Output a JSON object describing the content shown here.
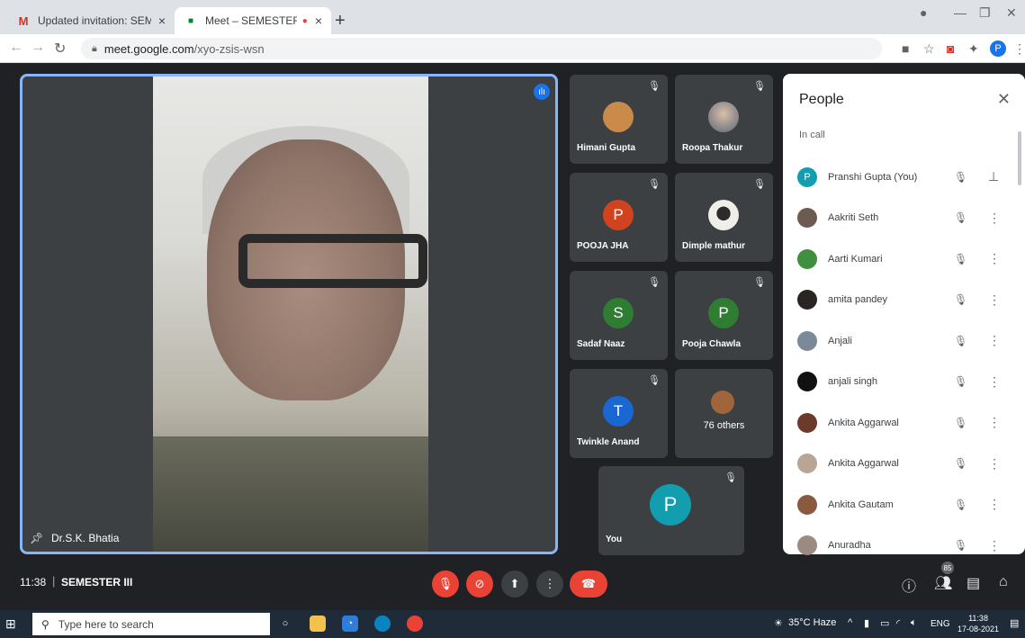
{
  "browser": {
    "tabs": [
      {
        "label": "Updated invitation: SEMESTER III",
        "close": "×",
        "favicon": "gmail-icon",
        "favicon_glyph": "M"
      },
      {
        "label": "Meet – SEMESTER III",
        "close": "×",
        "favicon": "meet-icon",
        "favicon_glyph": "■"
      }
    ],
    "url_host": "meet.google.com",
    "url_path": "/xyo-zsis-wsn",
    "profile_initial": "P"
  },
  "main_tile": {
    "name": "Dr.S.K. Bhatia"
  },
  "tiles": [
    {
      "name": "Himani Gupta",
      "avatar_type": "photo",
      "avatar_color": "#c98a4a"
    },
    {
      "name": "Roopa Thakur",
      "avatar_type": "photo",
      "avatar_color": "#8a8fa8"
    },
    {
      "name": "POOJA JHA",
      "avatar_type": "initial",
      "initial": "P",
      "avatar_color": "#d1421f"
    },
    {
      "name": "Dimple mathur",
      "avatar_type": "photo",
      "avatar_color": "#e8e6e1"
    },
    {
      "name": "Sadaf Naaz",
      "avatar_type": "initial",
      "initial": "S",
      "avatar_color": "#2e7d32"
    },
    {
      "name": "Pooja Chawla",
      "avatar_type": "initial",
      "initial": "P",
      "avatar_color": "#2e7d32"
    },
    {
      "name": "Twinkle Anand",
      "avatar_type": "initial",
      "initial": "T",
      "avatar_color": "#1967d2"
    },
    {
      "name": "76 others",
      "avatar_type": "group",
      "avatar_color": "#a0653a"
    }
  ],
  "self_tile": {
    "name": "You",
    "initial": "P",
    "avatar_color": "#129eaf"
  },
  "people": {
    "title": "People",
    "section": "In call",
    "participants": [
      {
        "name": "Pranshi Gupta (You)",
        "avatar_type": "initial",
        "initial": "P",
        "avatar_color": "#129eaf",
        "action": "pin"
      },
      {
        "name": "Aakriti Seth",
        "avatar_color": "#6d5a50",
        "action": "more"
      },
      {
        "name": "Aarti Kumari",
        "avatar_color": "#3f8f3f",
        "action": "more"
      },
      {
        "name": "amita pandey",
        "avatar_color": "#2a2522",
        "action": "more"
      },
      {
        "name": "Anjali",
        "avatar_color": "#7a8a99",
        "action": "more"
      },
      {
        "name": "anjali singh",
        "avatar_color": "#111111",
        "action": "more"
      },
      {
        "name": "Ankita Aggarwal",
        "avatar_color": "#6b3a2a",
        "action": "more"
      },
      {
        "name": "Ankita Aggarwal",
        "avatar_color": "#b9a596",
        "action": "more"
      },
      {
        "name": "Ankita Gautam",
        "avatar_color": "#8a5a40",
        "action": "more"
      },
      {
        "name": "Anuradha",
        "avatar_color": "#9a8a80",
        "action": "more"
      }
    ]
  },
  "meeting": {
    "time": "11:38",
    "separator": "|",
    "name": "SEMESTER III",
    "participant_count": "85"
  },
  "taskbar": {
    "search_placeholder": "Type here to search",
    "weather": "35°C  Haze",
    "lang": "ENG",
    "time": "11:38",
    "date": "17-08-2021"
  },
  "colors": {
    "accent": "#8ab4f8",
    "danger": "#ea4335",
    "meet_bg": "#202124",
    "tile_bg": "#3c4043"
  }
}
